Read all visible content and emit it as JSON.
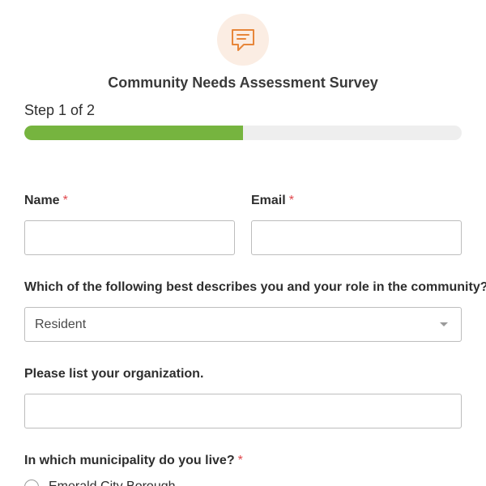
{
  "form": {
    "title": "Community Needs Assessment Survey",
    "icon": "chat-bubble-icon",
    "accent_color": "#e7863a",
    "icon_bg_color": "#fbede3"
  },
  "progress": {
    "step_text": "Step 1 of 2",
    "fraction": 0.5,
    "fill_color": "#76b43f",
    "track_color": "#eeeeee"
  },
  "fields": {
    "name": {
      "label": "Name",
      "required_mark": "*",
      "value": ""
    },
    "email": {
      "label": "Email",
      "required_mark": "*",
      "value": ""
    },
    "role": {
      "label": "Which of the following best describes you and your role in the community?",
      "required_mark": "*",
      "selected": "Resident"
    },
    "organization": {
      "label": "Please list your organization.",
      "value": ""
    },
    "municipality": {
      "label": "In which municipality do you live?",
      "required_mark": "*",
      "options": [
        "Emerald City Borough"
      ]
    }
  },
  "required_color": "#e0474c"
}
